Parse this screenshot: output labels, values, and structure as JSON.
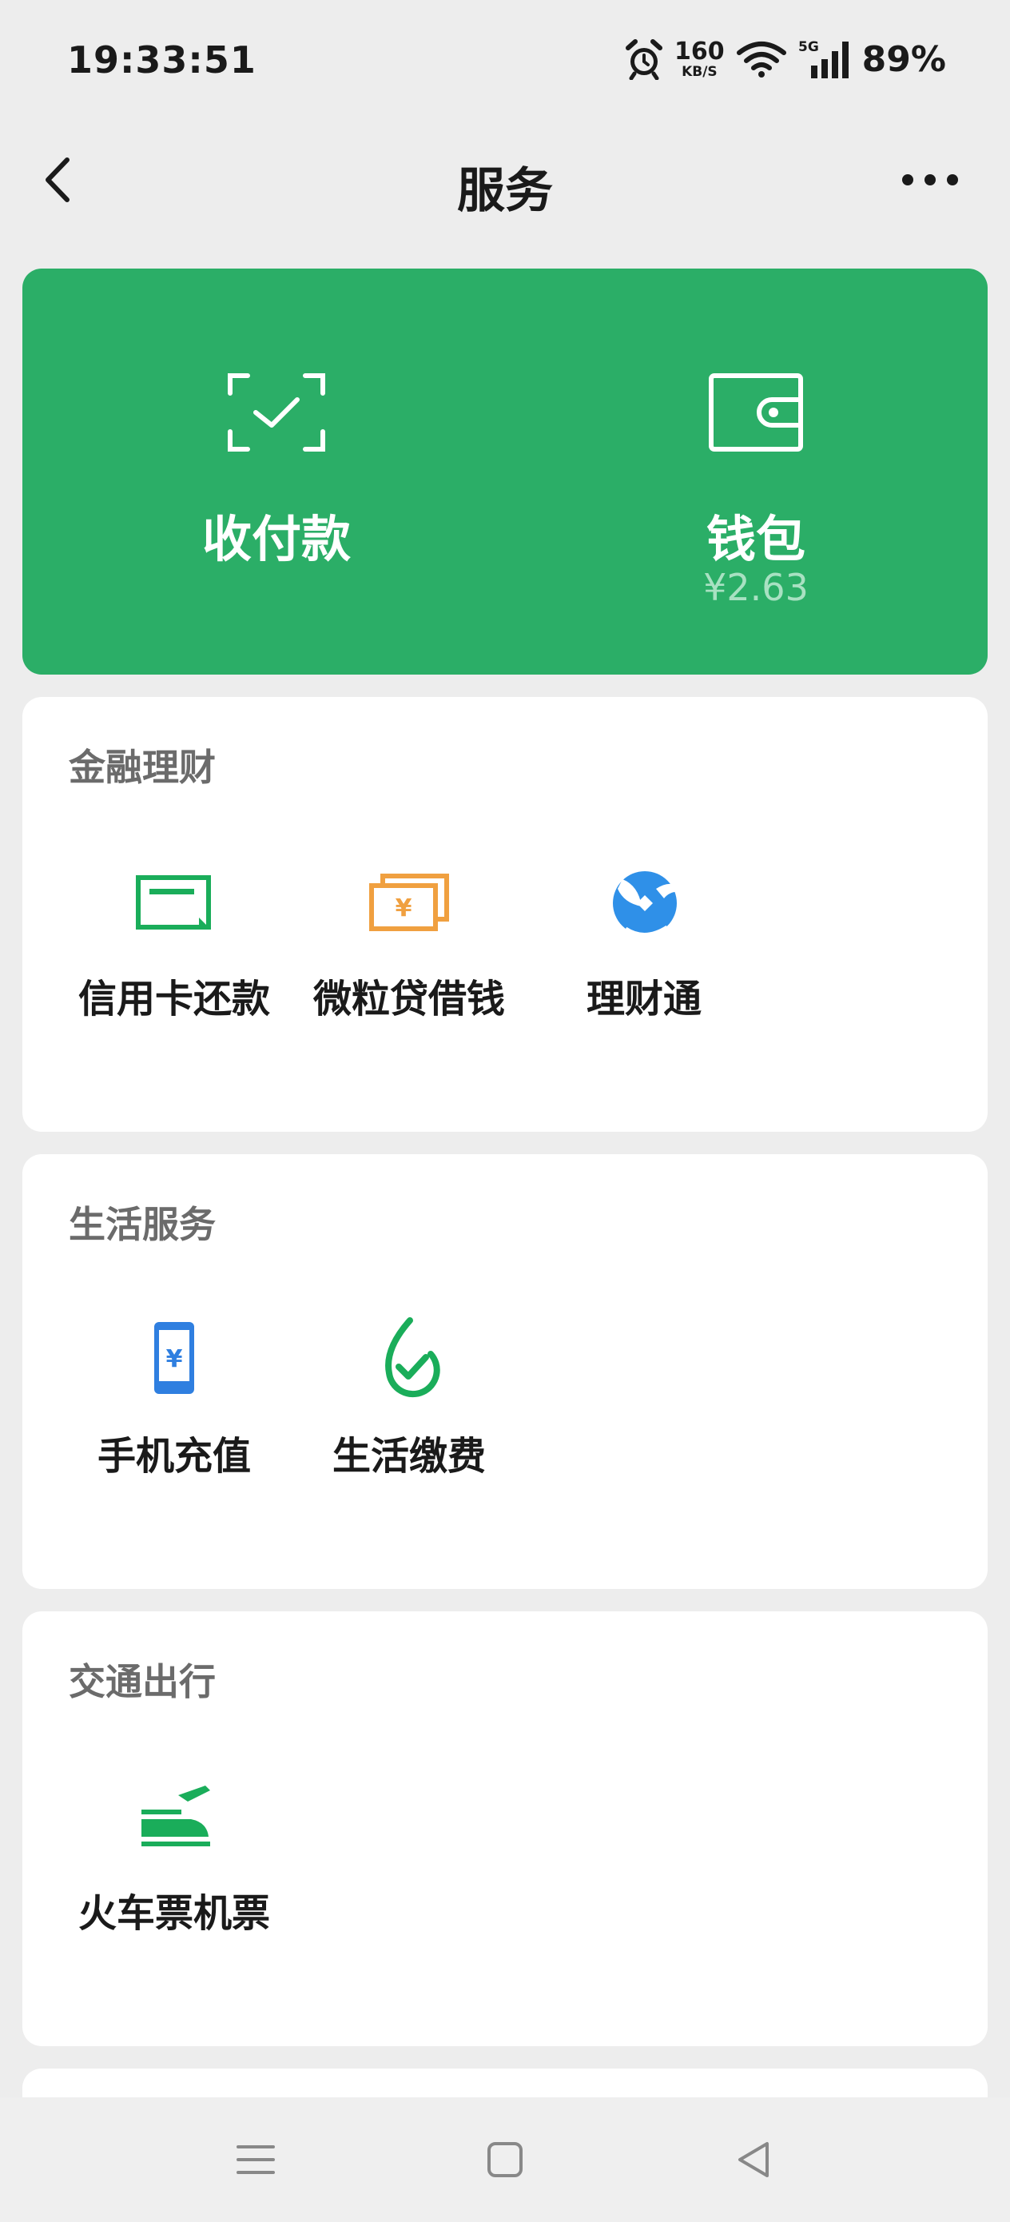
{
  "status_bar": {
    "time": "19:33:51",
    "net_speed": "160",
    "net_unit": "KB/S",
    "network": "5G",
    "battery": "89%",
    "icons": [
      "alarm-icon",
      "wifi-icon",
      "signal-icon"
    ]
  },
  "header": {
    "title": "服务",
    "back_icon": "back-icon",
    "more_icon": "more-icon"
  },
  "top_card": {
    "pay": {
      "label": "收付款",
      "icon": "scan-pay-icon"
    },
    "wallet": {
      "label": "钱包",
      "balance": "¥2.63",
      "icon": "wallet-icon"
    },
    "background_color": "#2bae67"
  },
  "sections": [
    {
      "title": "金融理财",
      "items": [
        {
          "label": "信用卡还款",
          "icon": "credit-card-icon",
          "color": "#1aad5a"
        },
        {
          "label": "微粒贷借钱",
          "icon": "loan-icon",
          "color": "#f0a040"
        },
        {
          "label": "理财通",
          "icon": "wealth-icon",
          "color": "#2f90e8"
        }
      ]
    },
    {
      "title": "生活服务",
      "items": [
        {
          "label": "手机充值",
          "icon": "phone-recharge-icon",
          "color": "#2f7fe0"
        },
        {
          "label": "生活缴费",
          "icon": "utility-bill-icon",
          "color": "#1aad5a"
        }
      ]
    },
    {
      "title": "交通出行",
      "items": [
        {
          "label": "火车票机票",
          "icon": "train-plane-icon",
          "color": "#1aad5a"
        }
      ]
    }
  ],
  "system_nav": [
    "menu-icon",
    "home-icon",
    "back-triangle-icon"
  ]
}
